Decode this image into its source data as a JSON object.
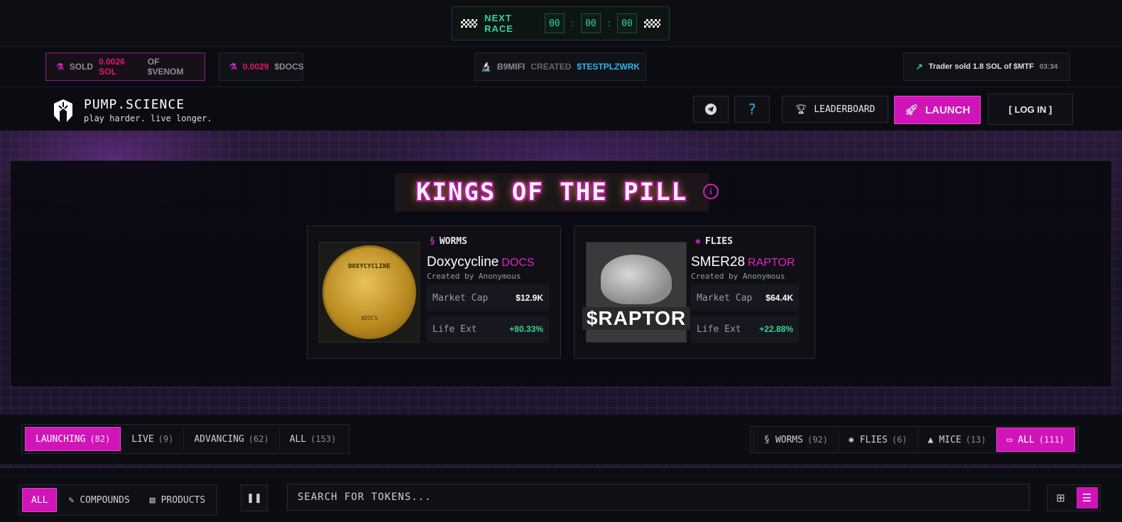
{
  "race": {
    "label": "NEXT RACE",
    "hours": "00",
    "minutes": "00",
    "seconds": "00"
  },
  "ticker": {
    "item1": {
      "action": "SOLD",
      "amount": "0.0026 SOL",
      "suffix": "OF $VENOM"
    },
    "item2": {
      "amount": "0.0029",
      "token": "$DOCS"
    },
    "item3": {
      "user": "B9MIFI",
      "action": "CREATED",
      "token": "$TESTPLZWRK"
    },
    "item4": {
      "text": "Trader sold 1.8 SOL of $MTF",
      "time": "03:34"
    }
  },
  "brand": {
    "title": "PUMP.SCIENCE",
    "tagline": "play harder. live longer."
  },
  "header": {
    "leaderboard_label": "LEADERBOARD",
    "launch_label": "LAUNCH",
    "login_label": "[ LOG IN ]",
    "help_label": "?"
  },
  "koth": {
    "title": "KINGS OF THE PILL",
    "cards": [
      {
        "category": "WORMS",
        "name": "Doxycycline",
        "ticker": "DOCS",
        "creator": "Created by Anonymous",
        "market_cap_label": "Market Cap",
        "market_cap": "$12.9K",
        "life_ext_label": "Life Ext",
        "life_ext": "+80.33%",
        "coin_top": "DOXYCYCLINE",
        "coin_bottom": "$DOCS"
      },
      {
        "category": "FLIES",
        "name": "SMER28",
        "ticker": "RAPTOR",
        "creator": "Created by Anonymous",
        "market_cap_label": "Market Cap",
        "market_cap": "$64.4K",
        "life_ext_label": "Life Ext",
        "life_ext": "+22.88%",
        "image_text": "$RAPTOR"
      }
    ]
  },
  "status_tabs": [
    {
      "label": "LAUNCHING",
      "count": "(82)",
      "active": true
    },
    {
      "label": "LIVE",
      "count": "(9)"
    },
    {
      "label": "ADVANCING",
      "count": "(62)"
    },
    {
      "label": "ALL",
      "count": "(153)"
    }
  ],
  "species_tabs": [
    {
      "label": "WORMS",
      "count": "(92)",
      "icon": "worm-icon"
    },
    {
      "label": "FLIES",
      "count": "(6)",
      "icon": "fly-icon"
    },
    {
      "label": "MICE",
      "count": "(13)",
      "icon": "mouse-icon"
    },
    {
      "label": "ALL",
      "count": "(111)",
      "icon": "stack-icon",
      "active": true
    }
  ],
  "type_tabs": [
    {
      "label": "ALL",
      "active": true
    },
    {
      "label": "COMPOUNDS",
      "icon": "pencil-icon"
    },
    {
      "label": "PRODUCTS",
      "icon": "box-icon"
    }
  ],
  "search": {
    "placeholder": "SEARCH FOR TOKENS..."
  },
  "colors": {
    "accent": "#d015b8",
    "green": "#36d39a",
    "cyan": "#29b7ee",
    "pink": "#e4136f"
  }
}
